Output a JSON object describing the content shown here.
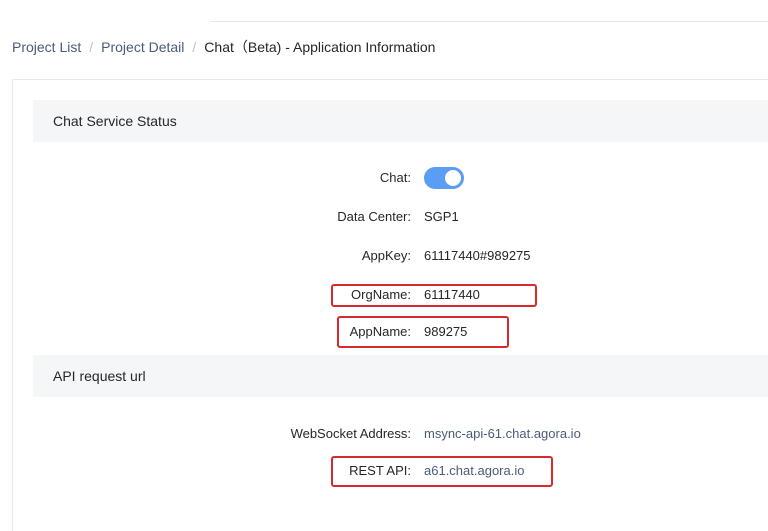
{
  "breadcrumb": {
    "project_list": "Project List",
    "project_detail": "Project Detail",
    "current": "Chat（Beta) - Application Information",
    "separator": "/"
  },
  "chat_service": {
    "title": "Chat Service Status",
    "chat_label": "Chat:",
    "chat_enabled": true,
    "data_center_label": "Data Center:",
    "data_center_value": "SGP1",
    "appkey_label": "AppKey:",
    "appkey_value": "61117440#989275",
    "orgname_label": "OrgName:",
    "orgname_value": "61117440",
    "appname_label": "AppName:",
    "appname_value": "989275"
  },
  "api_request": {
    "title": "API request url",
    "websocket_label": "WebSocket Address:",
    "websocket_value": "msync-api-61.chat.agora.io",
    "rest_label": "REST API:",
    "rest_value": "a61.chat.agora.io"
  },
  "colors": {
    "toggle_on": "#5b9cf5",
    "highlight": "#d72b2b",
    "link": "#4a5b7a"
  }
}
